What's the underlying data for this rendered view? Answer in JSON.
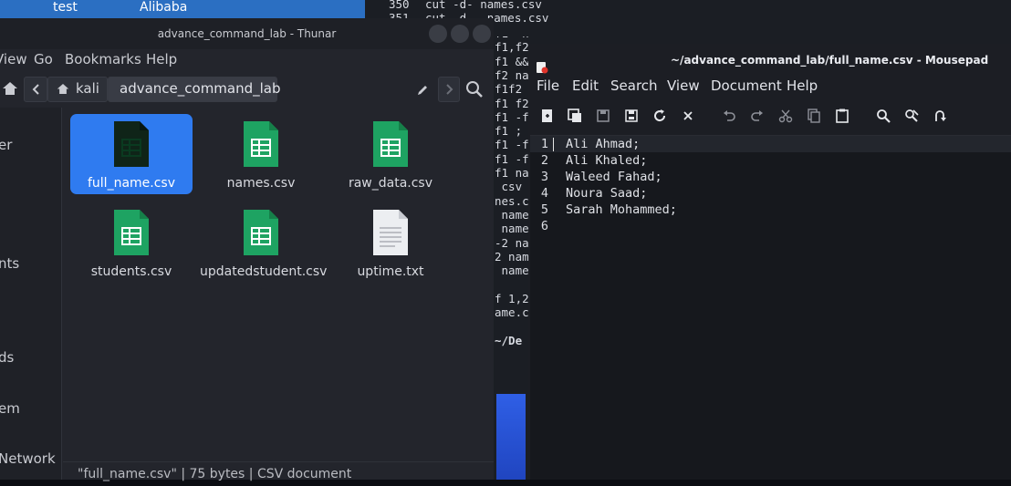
{
  "topbar": {
    "left": "test",
    "right": "Alibaba"
  },
  "terminal": {
    "lines": [
      {
        "num": "350",
        "cmd": "cut -d- names.csv"
      },
      {
        "num": "351",
        "cmd": "cut -d , names.csv"
      }
    ],
    "fragments": [
      "f1  names.csv",
      "f1,f2",
      "f1 &&",
      "f2 na",
      "f1f2",
      "f1 f2",
      "f1 -f",
      "f1 ;",
      "f1 -f",
      "f1 -f",
      "f1 na",
      " csv",
      "nes.c",
      " name",
      " name",
      "-2 na",
      "2 nam",
      " name",
      "",
      "f 1,2",
      "ame.c",
      "",
      "~/De"
    ]
  },
  "thunar": {
    "title": "advance_command_lab - Thunar",
    "menu": [
      "View",
      "Go",
      "Bookmarks",
      "Help"
    ],
    "path": [
      "kali",
      "advance_command_lab"
    ],
    "sidebar": [
      "er",
      "nts",
      "ds",
      "em",
      "Network"
    ],
    "files": [
      {
        "name": "full_name.csv",
        "type": "csv",
        "selected": true
      },
      {
        "name": "names.csv",
        "type": "csv",
        "selected": false
      },
      {
        "name": "raw_data.csv",
        "type": "csv",
        "selected": false
      },
      {
        "name": "students.csv",
        "type": "csv",
        "selected": false
      },
      {
        "name": "updatedstudent.csv",
        "type": "csv",
        "selected": false
      },
      {
        "name": "uptime.txt",
        "type": "txt",
        "selected": false
      }
    ],
    "status": "\"full_name.csv\" | 75 bytes | CSV document"
  },
  "mousepad": {
    "title": "~/advance_command_lab/full_name.csv - Mousepad",
    "menu": [
      "File",
      "Edit",
      "Search",
      "View",
      "Document",
      "Help"
    ],
    "toolbar_icons": [
      "new-document-icon",
      "new-window-icon",
      "save-icon",
      "save-as-icon",
      "reload-icon",
      "close-icon",
      "undo-icon",
      "redo-icon",
      "cut-icon",
      "copy-icon",
      "paste-icon",
      "find-icon",
      "find-replace-icon",
      "goto-icon"
    ],
    "lines": [
      {
        "num": "1",
        "text": "Ali Ahmad;"
      },
      {
        "num": "2",
        "text": "Ali Khaled;"
      },
      {
        "num": "3",
        "text": "Waleed Fahad;"
      },
      {
        "num": "4",
        "text": "Noura Saad;"
      },
      {
        "num": "5",
        "text": "Sarah Mohammed;"
      },
      {
        "num": "6",
        "text": ""
      }
    ]
  },
  "colors": {
    "accent": "#2f7bf0",
    "csv_green": "#1ea362",
    "titlebar": "#1e2026"
  }
}
